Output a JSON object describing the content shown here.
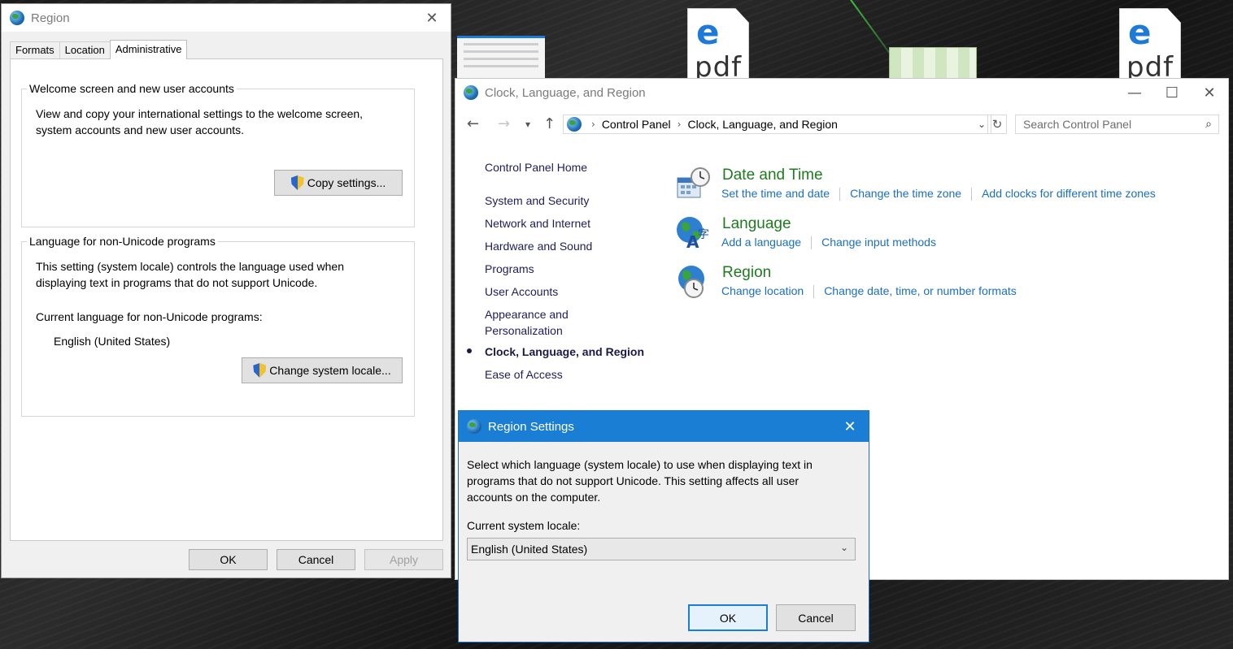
{
  "desktop": {
    "pdf_label": "pdf"
  },
  "region_dialog": {
    "title": "Region",
    "tabs": [
      {
        "label": "Formats"
      },
      {
        "label": "Location"
      },
      {
        "label": "Administrative"
      }
    ],
    "welcome_group": {
      "title": "Welcome screen and new user accounts",
      "text_line1": "View and copy your international settings to the welcome screen,",
      "text_line2": "system accounts and new user accounts.",
      "copy_button": "Copy settings..."
    },
    "nonunicode_group": {
      "title": "Language for non-Unicode programs",
      "text_line1": "This setting (system locale) controls the language used when",
      "text_line2": "displaying text in programs that do not support Unicode.",
      "current_label": "Current language for non-Unicode programs:",
      "current_value": "English (United States)",
      "change_button": "Change system locale..."
    },
    "ok": "OK",
    "cancel": "Cancel",
    "apply": "Apply"
  },
  "control_panel": {
    "title": "Clock, Language, and Region",
    "breadcrumb": [
      "Control Panel",
      "Clock, Language, and Region"
    ],
    "search_placeholder": "Search Control Panel",
    "sidebar": [
      {
        "label": "Control Panel Home"
      },
      {
        "label": "System and Security"
      },
      {
        "label": "Network and Internet"
      },
      {
        "label": "Hardware and Sound"
      },
      {
        "label": "Programs"
      },
      {
        "label": "User Accounts"
      },
      {
        "label": "Appearance and"
      },
      {
        "label": "Personalization"
      },
      {
        "label": "Clock, Language, and Region"
      },
      {
        "label": "Ease of Access"
      }
    ],
    "categories": [
      {
        "title": "Date and Time",
        "icon": "clock-calendar-icon",
        "links": [
          "Set the time and date",
          "Change the time zone",
          "Add clocks for different time zones"
        ]
      },
      {
        "title": "Language",
        "icon": "language-globe-icon",
        "links": [
          "Add a language",
          "Change input methods"
        ]
      },
      {
        "title": "Region",
        "icon": "region-globe-clock-icon",
        "links": [
          "Change location",
          "Change date, time, or number formats"
        ]
      }
    ]
  },
  "region_settings": {
    "title": "Region Settings",
    "text_line1": "Select which language (system locale) to use when displaying text in",
    "text_line2": "programs that do not support Unicode. This setting affects all user",
    "text_line3": "accounts on the computer.",
    "locale_label": "Current system locale:",
    "locale_value": "English (United States)",
    "ok": "OK",
    "cancel": "Cancel"
  },
  "colors": {
    "accent_blue": "#1a7fd4",
    "link_blue": "#1a6fc1",
    "category_green": "#1e7b1e"
  }
}
